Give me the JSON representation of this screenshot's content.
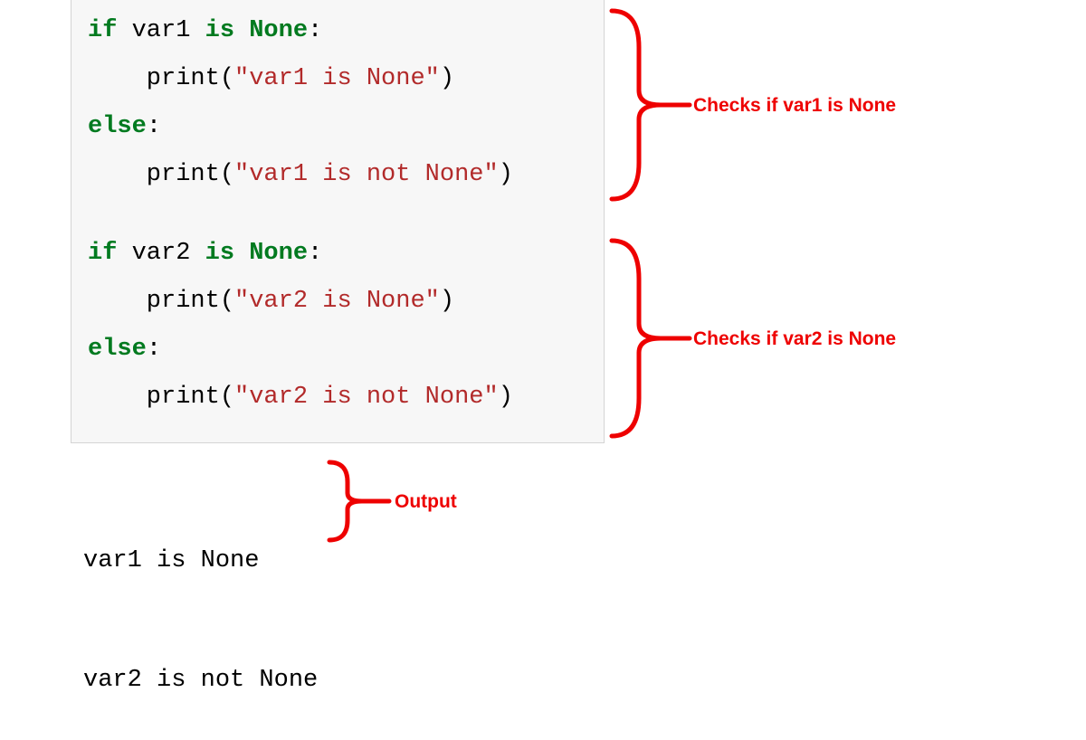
{
  "code": {
    "block1": {
      "line1": {
        "kw1": "if",
        "var": " var1 ",
        "kw2": "is",
        "sp": " ",
        "kw3": "None",
        "colon": ":"
      },
      "line2": {
        "indent": "    print(",
        "str": "\"var1 is None\"",
        "close": ")"
      },
      "line3": {
        "kw": "else",
        "colon": ":"
      },
      "line4": {
        "indent": "    print(",
        "str": "\"var1 is not None\"",
        "close": ")"
      }
    },
    "block2": {
      "line1": {
        "kw1": "if",
        "var": " var2 ",
        "kw2": "is",
        "sp": " ",
        "kw3": "None",
        "colon": ":"
      },
      "line2": {
        "indent": "    print(",
        "str": "\"var2 is None\"",
        "close": ")"
      },
      "line3": {
        "kw": "else",
        "colon": ":"
      },
      "line4": {
        "indent": "    print(",
        "str": "\"var2 is not None\"",
        "close": ")"
      }
    }
  },
  "output": {
    "line1": "var1 is None",
    "line2": "var2 is not None"
  },
  "annotations": {
    "block1": "Checks if var1 is None",
    "block2": "Checks if var2 is None",
    "output": "Output"
  }
}
